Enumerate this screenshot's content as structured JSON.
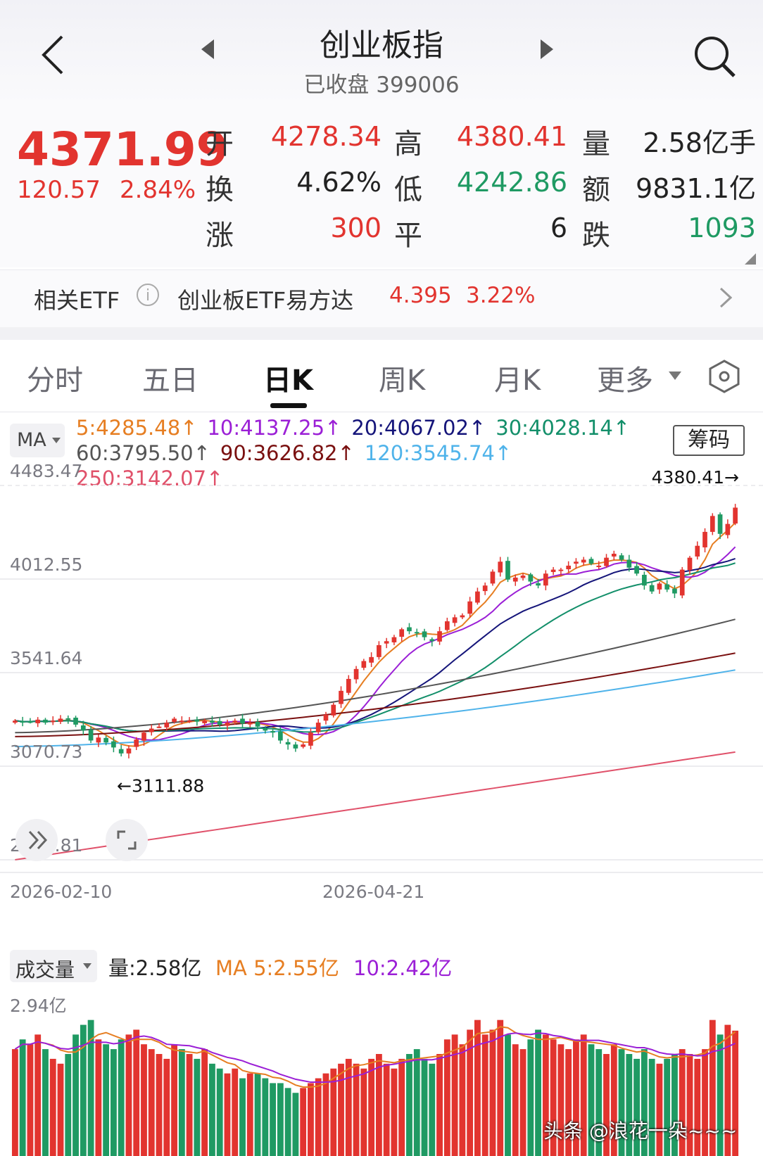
{
  "header": {
    "title": "创业板指",
    "subtitle": "已收盘 399006"
  },
  "quote": {
    "price": "4371.99",
    "change": "120.57",
    "change_pct": "2.84%",
    "rows": [
      [
        {
          "k": "开",
          "v": "4278.34",
          "c": "red"
        },
        {
          "k": "高",
          "v": "4380.41",
          "c": "red"
        },
        {
          "k": "量",
          "v": "2.58亿手",
          "c": "dark"
        }
      ],
      [
        {
          "k": "换",
          "v": "4.62%",
          "c": "dark"
        },
        {
          "k": "低",
          "v": "4242.86",
          "c": "green"
        },
        {
          "k": "额",
          "v": "9831.1亿",
          "c": "dark"
        }
      ],
      [
        {
          "k": "涨",
          "v": "300",
          "c": "red"
        },
        {
          "k": "平",
          "v": "6",
          "c": "dark"
        },
        {
          "k": "跌",
          "v": "1093",
          "c": "green"
        }
      ]
    ]
  },
  "etf": {
    "label": "相关ETF",
    "name": "创业板ETF易方达",
    "price": "4.395",
    "pct": "3.22%"
  },
  "tabs": [
    "分时",
    "五日",
    "日K",
    "周K",
    "月K",
    "更多"
  ],
  "ma_bar": {
    "selector": "MA",
    "button": "筹码",
    "items": [
      {
        "t": "5:4285.48↑",
        "color": "#e67e22"
      },
      {
        "t": "10:4137.25↑",
        "color": "#9b1fd6"
      },
      {
        "t": "20:4067.02↑",
        "color": "#15157a"
      },
      {
        "t": "30:4028.14↑",
        "color": "#138f6a"
      },
      {
        "t": "60:3795.50↑",
        "color": "#555555"
      },
      {
        "t": "90:3626.82↑",
        "color": "#7a1010"
      },
      {
        "t": "120:3545.74↑",
        "color": "#4fb3ea"
      },
      {
        "t": "250:3142.07↑",
        "color": "#e0516a"
      }
    ]
  },
  "volume_bar": {
    "selector": "成交量",
    "vol": "量:2.58亿",
    "ma5": "MA 5:2.55亿",
    "ma10": "10:2.42亿",
    "ymax_label": "2.94亿"
  },
  "watermark": "头条 @浪花一朵~~~",
  "colors": {
    "up": "#e2342f",
    "down": "#1f9a63",
    "ma5": "#e67e22",
    "ma10": "#9b1fd6",
    "ma20": "#15157a",
    "ma30": "#138f6a",
    "ma60": "#555555",
    "ma90": "#7a1010",
    "ma120": "#4fb3ea",
    "ma250": "#e0516a"
  },
  "chart_data": {
    "type": "candlestick",
    "y_ticks": [
      "4483.47",
      "4012.55",
      "3541.64",
      "3070.73",
      "2599.81"
    ],
    "ylim": [
      2599.81,
      4483.47
    ],
    "x_labels": [
      "2026-02-10",
      "2026-04-21"
    ],
    "high_marker": "4380.41→",
    "low_marker": "←3111.88",
    "closes": [
      3300,
      3290,
      3295,
      3305,
      3290,
      3300,
      3310,
      3305,
      3280,
      3250,
      3200,
      3215,
      3190,
      3165,
      3135,
      3160,
      3205,
      3240,
      3260,
      3270,
      3290,
      3310,
      3300,
      3300,
      3295,
      3300,
      3290,
      3280,
      3290,
      3300,
      3285,
      3290,
      3270,
      3250,
      3240,
      3200,
      3180,
      3160,
      3180,
      3240,
      3290,
      3330,
      3380,
      3450,
      3510,
      3560,
      3600,
      3620,
      3680,
      3700,
      3720,
      3760,
      3750,
      3745,
      3720,
      3700,
      3750,
      3800,
      3820,
      3830,
      3900,
      3950,
      3980,
      4050,
      4100,
      4010,
      4020,
      4030,
      4000,
      3980,
      4040,
      4060,
      4060,
      4080,
      4100,
      4110,
      4090,
      4080,
      4120,
      4140,
      4110,
      4070,
      4040,
      3980,
      3950,
      3990,
      3960,
      3940,
      4060,
      4120,
      4180,
      4250,
      4330,
      4240,
      4290,
      4372
    ],
    "volume_ylim": [
      0,
      2.94
    ],
    "volume": [
      2.2,
      2.4,
      2.3,
      2.5,
      2.2,
      2.0,
      1.9,
      2.1,
      2.5,
      2.7,
      2.8,
      2.4,
      2.3,
      2.2,
      2.4,
      2.5,
      2.6,
      2.3,
      2.2,
      2.1,
      2.0,
      2.3,
      2.2,
      2.1,
      2.0,
      2.2,
      1.9,
      1.8,
      1.7,
      1.8,
      1.6,
      1.7,
      1.7,
      1.6,
      1.5,
      1.5,
      1.4,
      1.3,
      1.4,
      1.5,
      1.6,
      1.7,
      1.8,
      1.9,
      2.0,
      1.9,
      1.8,
      2.0,
      2.1,
      1.9,
      1.8,
      2.0,
      2.1,
      2.2,
      2.0,
      1.9,
      2.1,
      2.4,
      2.5,
      2.3,
      2.6,
      2.8,
      2.5,
      2.6,
      2.8,
      2.5,
      2.3,
      2.2,
      2.4,
      2.6,
      2.5,
      2.4,
      2.3,
      2.2,
      2.4,
      2.5,
      2.3,
      2.2,
      2.1,
      2.3,
      2.2,
      2.1,
      2.0,
      2.2,
      2.0,
      1.9,
      2.0,
      2.1,
      2.2,
      2.1,
      2.0,
      2.2,
      2.8,
      2.5,
      2.7,
      2.58
    ]
  }
}
